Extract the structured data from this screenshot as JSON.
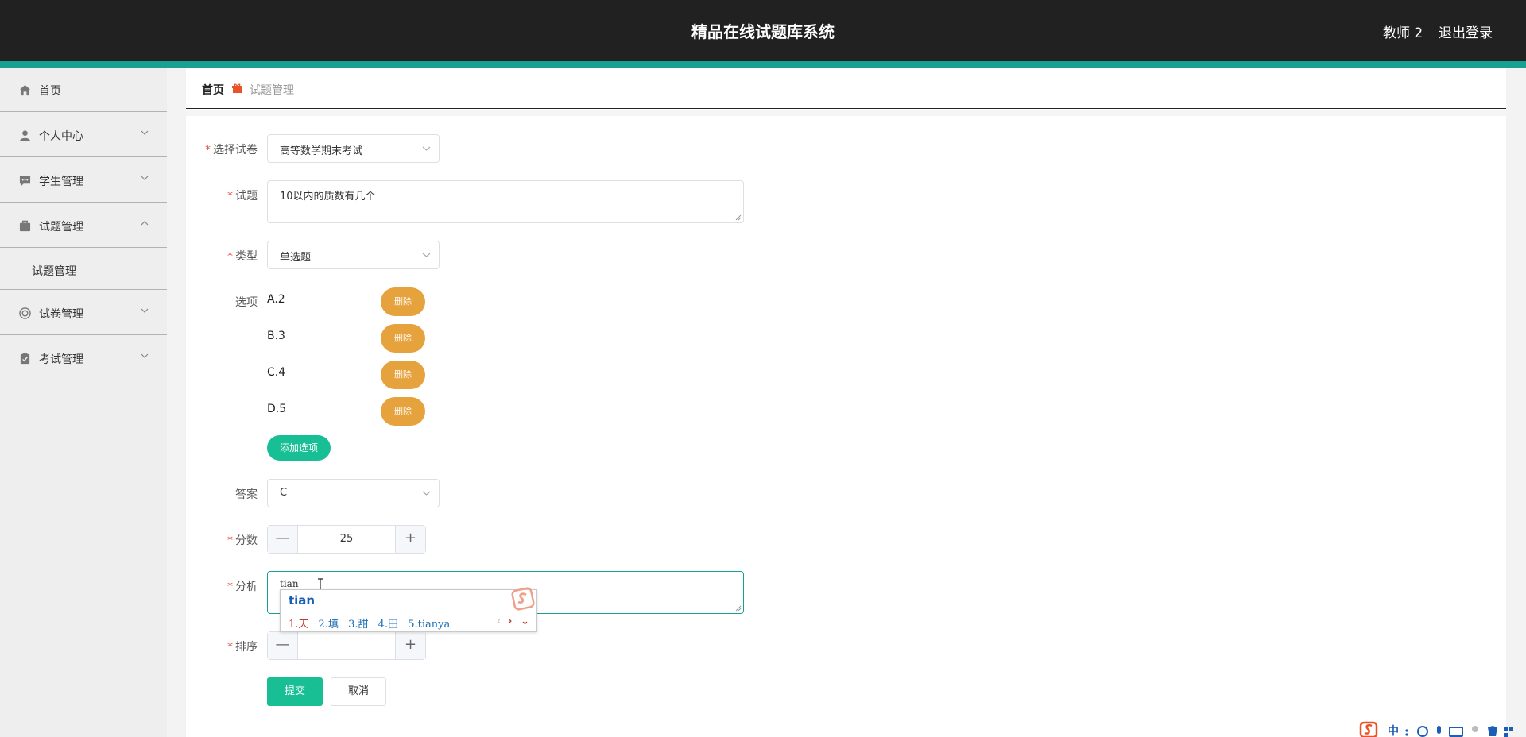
{
  "header": {
    "title": "精品在线试题库系统",
    "user": "教师 2",
    "logout": "退出登录"
  },
  "sidebar": {
    "items": [
      {
        "label": "首页",
        "icon": "home-icon"
      },
      {
        "label": "个人中心",
        "icon": "user-icon"
      },
      {
        "label": "学生管理",
        "icon": "chat-icon"
      },
      {
        "label": "试题管理",
        "icon": "briefcase-icon"
      },
      {
        "label": "试卷管理",
        "icon": "target-icon"
      },
      {
        "label": "考试管理",
        "icon": "clipboard-icon"
      }
    ],
    "sub_items": [
      {
        "label": "试题管理"
      }
    ]
  },
  "breadcrumb": {
    "home": "首页",
    "current": "试题管理"
  },
  "form": {
    "paper_label": "选择试卷",
    "paper_value": "高等数学期末考试",
    "question_label": "试题",
    "question_value": "10以内的质数有几个",
    "type_label": "类型",
    "type_value": "单选题",
    "options_label": "选项",
    "options": [
      "A.2",
      "B.3",
      "C.4",
      "D.5"
    ],
    "delete_label": "删除",
    "add_option_label": "添加选项",
    "answer_label": "答案",
    "answer_value": "C",
    "score_label": "分数",
    "score_value": "25",
    "analysis_label": "分析",
    "analysis_value": "tian",
    "order_label": "排序",
    "order_value": "",
    "minus": "—",
    "plus": "+",
    "submit_label": "提交",
    "cancel_label": "取消"
  },
  "ime": {
    "input": "tian",
    "candidates": [
      "1.天",
      "2.填",
      "3.甜",
      "4.田",
      "5.tianya"
    ],
    "prev": "‹",
    "next": "›",
    "expand": "⌄"
  },
  "colors": {
    "accent": "#18a092",
    "header_bg": "#212121",
    "delete": "#e6a23c",
    "primary_btn": "#18bf94",
    "required": "#e74c3c"
  }
}
